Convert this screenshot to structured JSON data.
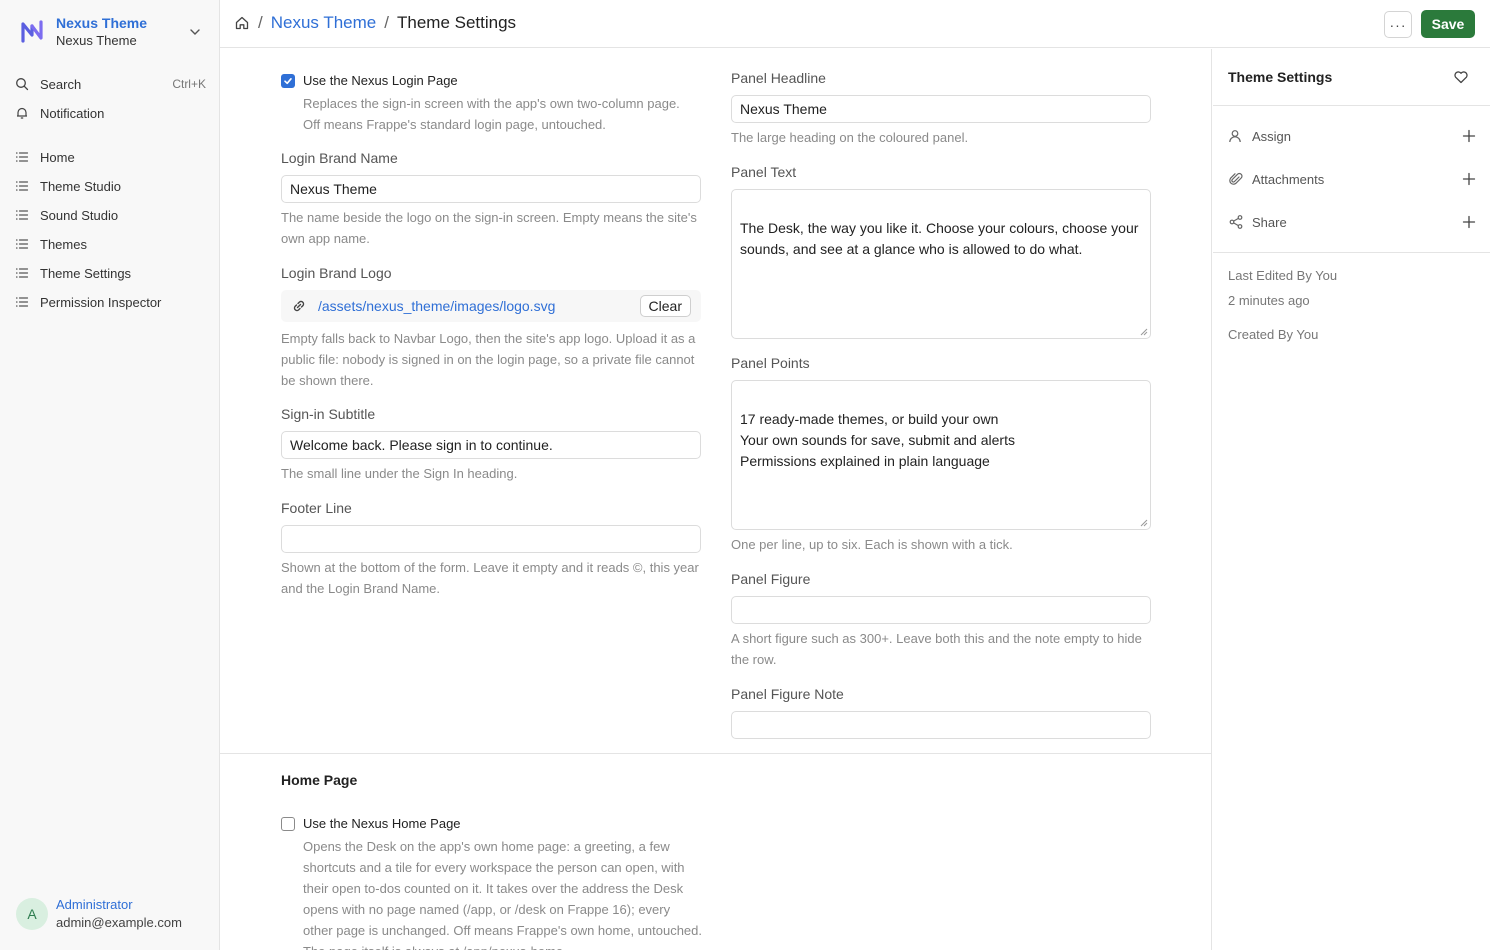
{
  "sidebar": {
    "brand_name": "Nexus Theme",
    "brand_sub": "Nexus Theme",
    "search_label": "Search",
    "search_shortcut": "Ctrl+K",
    "notification_label": "Notification",
    "items": [
      {
        "label": "Home"
      },
      {
        "label": "Theme Studio"
      },
      {
        "label": "Sound Studio"
      },
      {
        "label": "Themes"
      },
      {
        "label": "Theme Settings"
      },
      {
        "label": "Permission Inspector"
      }
    ],
    "user": {
      "initial": "A",
      "name": "Administrator",
      "email": "admin@example.com"
    }
  },
  "header": {
    "crumb_parent": "Nexus Theme",
    "crumb_current": "Theme Settings",
    "more_label": "···",
    "save_label": "Save"
  },
  "form": {
    "use_login": {
      "label": "Use the Nexus Login Page",
      "checked": true,
      "help": "Replaces the sign-in screen with the app's own two-column page. Off means Frappe's standard login page, untouched."
    },
    "brand_name": {
      "label": "Login Brand Name",
      "value": "Nexus Theme",
      "help": "The name beside the logo on the sign-in screen. Empty means the site's own app name."
    },
    "brand_logo": {
      "label": "Login Brand Logo",
      "value": "/assets/nexus_theme/images/logo.svg",
      "clear_label": "Clear",
      "help": "Empty falls back to Navbar Logo, then the site's app logo. Upload it as a public file: nobody is signed in on the login page, so a private file cannot be shown there."
    },
    "subtitle": {
      "label": "Sign-in Subtitle",
      "value": "Welcome back. Please sign in to continue.",
      "help": "The small line under the Sign In heading."
    },
    "footer": {
      "label": "Footer Line",
      "value": "",
      "help": "Shown at the bottom of the form. Leave it empty and it reads ©, this year and the Login Brand Name."
    },
    "headline": {
      "label": "Panel Headline",
      "value": "Nexus Theme",
      "help": "The large heading on the coloured panel."
    },
    "panel_text": {
      "label": "Panel Text",
      "value": "The Desk, the way you like it. Choose your colours, choose your sounds, and see at a glance who is allowed to do what."
    },
    "panel_points": {
      "label": "Panel Points",
      "value": "17 ready-made themes, or build your own\nYour own sounds for save, submit and alerts\nPermissions explained in plain language",
      "help": "One per line, up to six. Each is shown with a tick."
    },
    "panel_figure": {
      "label": "Panel Figure",
      "value": "",
      "help": "A short figure such as 300+. Leave both this and the note empty to hide the row."
    },
    "panel_figure_note": {
      "label": "Panel Figure Note",
      "value": ""
    },
    "home_section_title": "Home Page",
    "use_home": {
      "label": "Use the Nexus Home Page",
      "checked": false,
      "help": "Opens the Desk on the app's own home page: a greeting, a few shortcuts and a tile for every workspace the person can open, with their open to-dos counted on it. It takes over the address the Desk opens with no page named (/app, or /desk on Frappe 16); every other page is unchanged. Off means Frappe's own home, untouched. The page itself is always at /app/nexus-home."
    }
  },
  "right_panel": {
    "title": "Theme Settings",
    "assign": "Assign",
    "attachments": "Attachments",
    "share": "Share",
    "last_edited": "Last Edited By You",
    "edited_time": "2 minutes ago",
    "created": "Created By You"
  },
  "colors": {
    "accent": "#2f6fd6",
    "save": "#2b7a3b"
  }
}
